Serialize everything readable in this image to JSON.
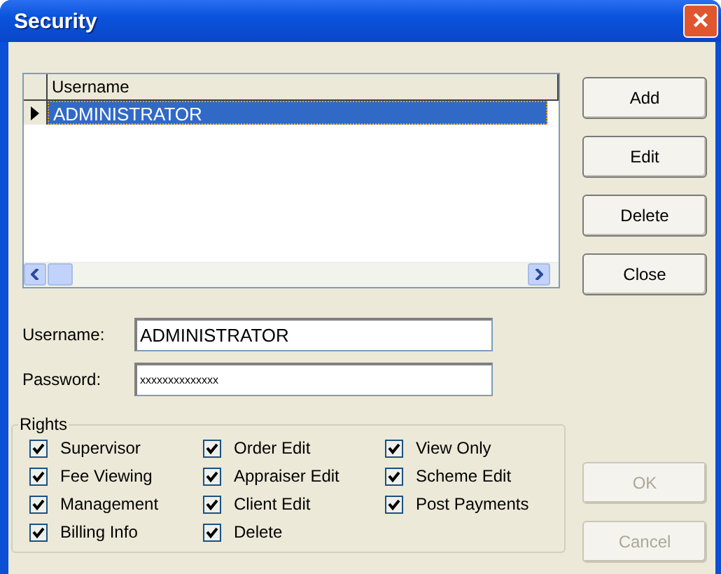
{
  "window": {
    "title": "Security",
    "close_label": "×"
  },
  "grid": {
    "columns": [
      "Username"
    ],
    "rows": [
      {
        "cells": [
          "ADMINISTRATOR"
        ],
        "selected": true,
        "current": true
      }
    ]
  },
  "buttons": [
    {
      "label": "Add",
      "disabled": false
    },
    {
      "label": "Edit",
      "disabled": false
    },
    {
      "label": "Delete",
      "disabled": false
    },
    {
      "label": "Close",
      "disabled": false
    }
  ],
  "fields": [
    {
      "label": "Username:",
      "value": "ADMINISTRATOR"
    },
    {
      "label": "Password:",
      "value": "xxxxxxxxxxxxxx"
    }
  ],
  "rights": {
    "title": "Rights",
    "columns": [
      [
        {
          "label": "Supervisor",
          "checked": true
        },
        {
          "label": "Fee Viewing",
          "checked": true
        },
        {
          "label": "Management",
          "checked": true
        },
        {
          "label": "Billing Info",
          "checked": true
        }
      ],
      [
        {
          "label": "Order Edit",
          "checked": true
        },
        {
          "label": "Appraiser Edit",
          "checked": true
        },
        {
          "label": "Client Edit",
          "checked": true
        },
        {
          "label": "Delete",
          "checked": true
        }
      ],
      [
        {
          "label": "View Only",
          "checked": true
        },
        {
          "label": "Scheme Edit",
          "checked": true
        },
        {
          "label": "Post Payments",
          "checked": true
        }
      ]
    ]
  },
  "dialog_buttons": [
    {
      "label": "OK",
      "disabled": true
    },
    {
      "label": "Cancel",
      "disabled": true
    }
  ]
}
